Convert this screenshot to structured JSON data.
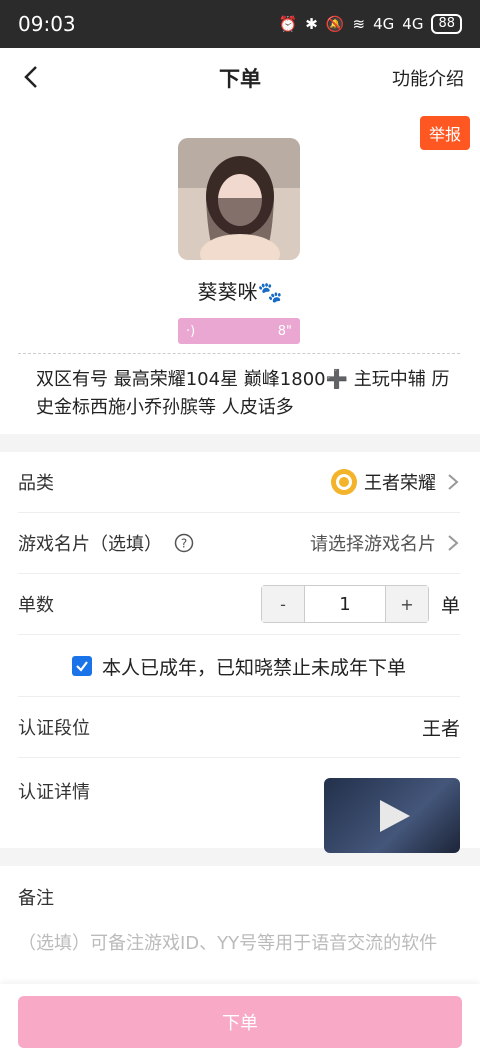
{
  "status_bar": {
    "time": "09:03",
    "battery": "88",
    "signal1": "4G",
    "signal2": "4G"
  },
  "nav": {
    "title": "下单",
    "right_label": "功能介绍"
  },
  "profile": {
    "report_label": "举报",
    "nickname": "葵葵咪🐾",
    "voice_duration": "8\"",
    "intro": "双区有号 最高荣耀104星 巅峰1800➕ 主玩中辅 历史金标西施小乔孙膑等 人皮话多"
  },
  "form": {
    "category_label": "品类",
    "category_value": "王者荣耀",
    "game_card_label": "游戏名片（选填）",
    "game_card_placeholder": "请选择游戏名片",
    "quantity_label": "单数",
    "quantity_value": "1",
    "quantity_unit": "单",
    "minus_label": "-",
    "plus_label": "+",
    "adult_confirm": "本人已成年，已知晓禁止未成年下单",
    "adult_checked": true,
    "rank_label": "认证段位",
    "rank_value": "王者",
    "detail_label": "认证详情"
  },
  "notes": {
    "title": "备注",
    "placeholder": "（选填）可备注游戏ID、YY号等用于语音交流的软件"
  },
  "submit_label": "下单",
  "colors": {
    "accent_pink": "#f7a9c6",
    "report_orange": "#ff5722",
    "checkbox_blue": "#1a73e8"
  }
}
